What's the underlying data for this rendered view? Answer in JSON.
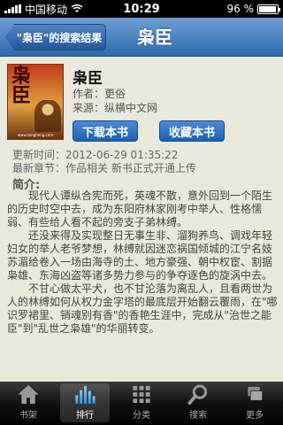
{
  "status_bar": {
    "carrier": "中国移动",
    "time": "10:29",
    "battery_percent": "96 %",
    "battery_level": 0.96
  },
  "nav": {
    "back_label": "\"枭臣\"的搜索结果",
    "title": "枭臣"
  },
  "book": {
    "title": "枭臣",
    "author": "作者：更俗",
    "source": "来源：纵横中文网",
    "cover_title": "枭臣",
    "cover_url": "www.zongheng.com"
  },
  "actions": {
    "download_label": "下载本书",
    "favorite_label": "收藏本书"
  },
  "info": {
    "updated": "更新时间：2012-06-29 01:35:22",
    "latest_chapter": "最新章节：作品相关 新书正式开通上传"
  },
  "intro": {
    "label": "简介:",
    "paragraphs": [
      "现代人谭纵合宪而死，英魂不散，意外回到一个陌生的历史时空中去，成为东阳府林家刚考中举人、性格懦弱、有些给人看不起的旁支子弟林缚。",
      "还没来得及实现整日无事生非、溜狗养鸟、调戏年轻妇女的举人老爷梦想，林缚就因迷恋祸国倾城的江宁名妓苏湄给卷入一场由海寺的土、地方豪强、朝中权宦、割据枭雄、东海凶盗等诸多势力参与的争夺逐色的旋涡中去。",
      "不甘心做太平犬，也不甘沦落为离乱人，且看两世为人的林缚如何从权力金字塔的最底层开始翻云覆雨，在\"哪识罗裙里、销魂别有香\"的香艳生涯中，完成从\"治世之能臣\"到\"乱世之枭雄\"的华丽转变。"
    ]
  },
  "tabs": [
    {
      "label": "书架",
      "icon": "house-icon",
      "active": false
    },
    {
      "label": "排行",
      "icon": "bar-chart-icon",
      "active": true
    },
    {
      "label": "分类",
      "icon": "grid-icon",
      "active": false
    },
    {
      "label": "搜索",
      "icon": "search-icon",
      "active": false
    },
    {
      "label": "更多",
      "icon": "more-icon",
      "active": false
    }
  ],
  "colors": {
    "nav_bar": "#3a74b8",
    "button": "#2a6cc0",
    "background": "#e9e8dc",
    "tab_bar": "#111111"
  }
}
